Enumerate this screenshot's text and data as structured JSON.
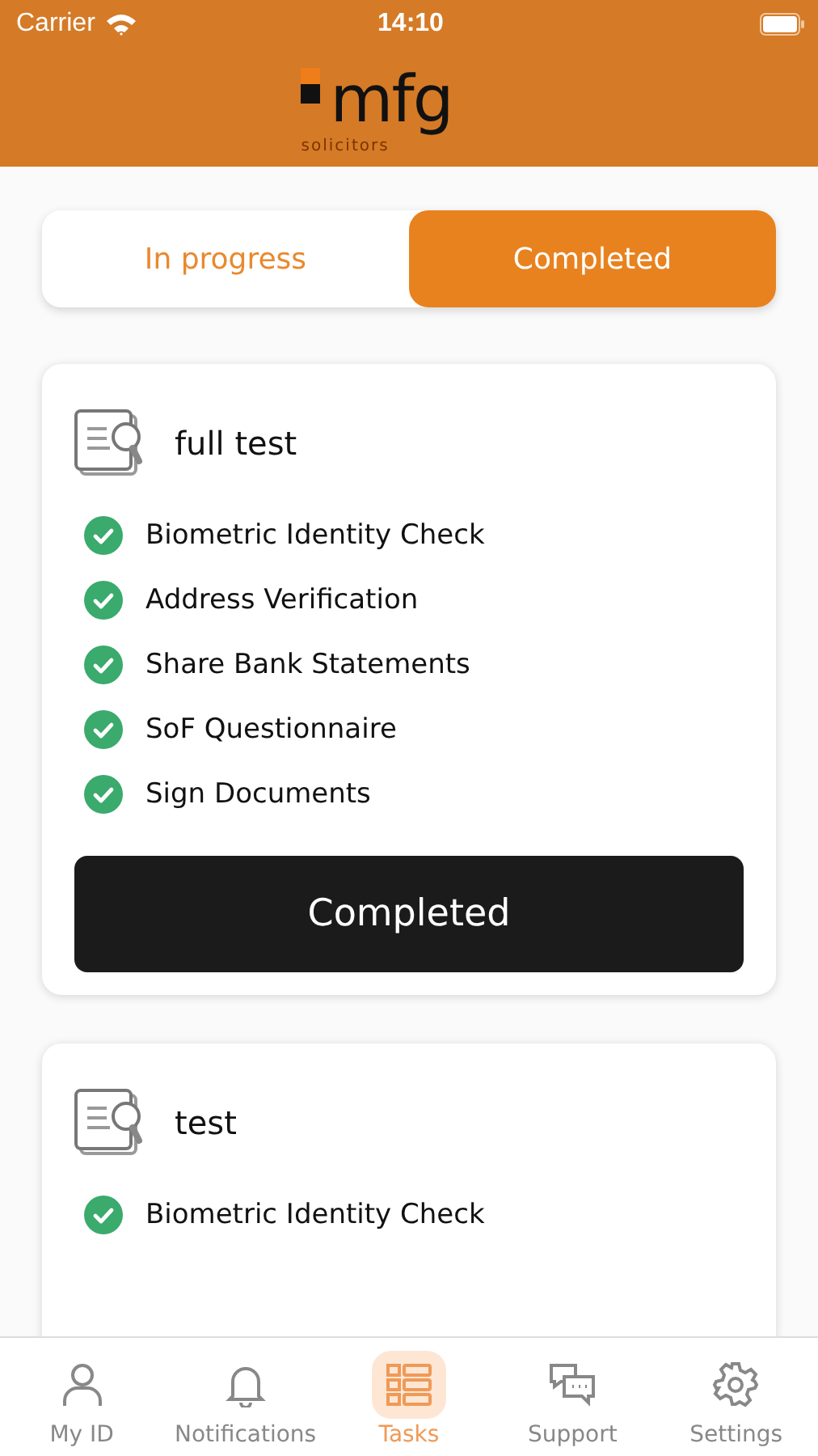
{
  "status_bar": {
    "carrier": "Carrier",
    "time": "14:10"
  },
  "header": {
    "logo": "mfg",
    "logo_subtitle": "solicitors"
  },
  "segments": [
    {
      "label": "In progress",
      "selected": false
    },
    {
      "label": "Completed",
      "selected": true
    }
  ],
  "cards": [
    {
      "title": "full test",
      "tasks": [
        {
          "label": "Biometric Identity Check",
          "done": true
        },
        {
          "label": "Address Verification",
          "done": true
        },
        {
          "label": "Share Bank Statements",
          "done": true
        },
        {
          "label": "SoF Questionnaire",
          "done": true
        },
        {
          "label": "Sign Documents",
          "done": true
        }
      ],
      "button": "Completed"
    },
    {
      "title": "test",
      "tasks": [
        {
          "label": "Biometric Identity Check",
          "done": true
        }
      ]
    }
  ],
  "tab_bar": [
    {
      "label": "My ID",
      "kind": "person",
      "selected": false
    },
    {
      "label": "Notifications",
      "kind": "bell",
      "selected": false
    },
    {
      "label": "Tasks",
      "kind": "tasks",
      "selected": true
    },
    {
      "label": "Support",
      "kind": "chat",
      "selected": false
    },
    {
      "label": "Settings",
      "kind": "gear",
      "selected": false
    }
  ]
}
